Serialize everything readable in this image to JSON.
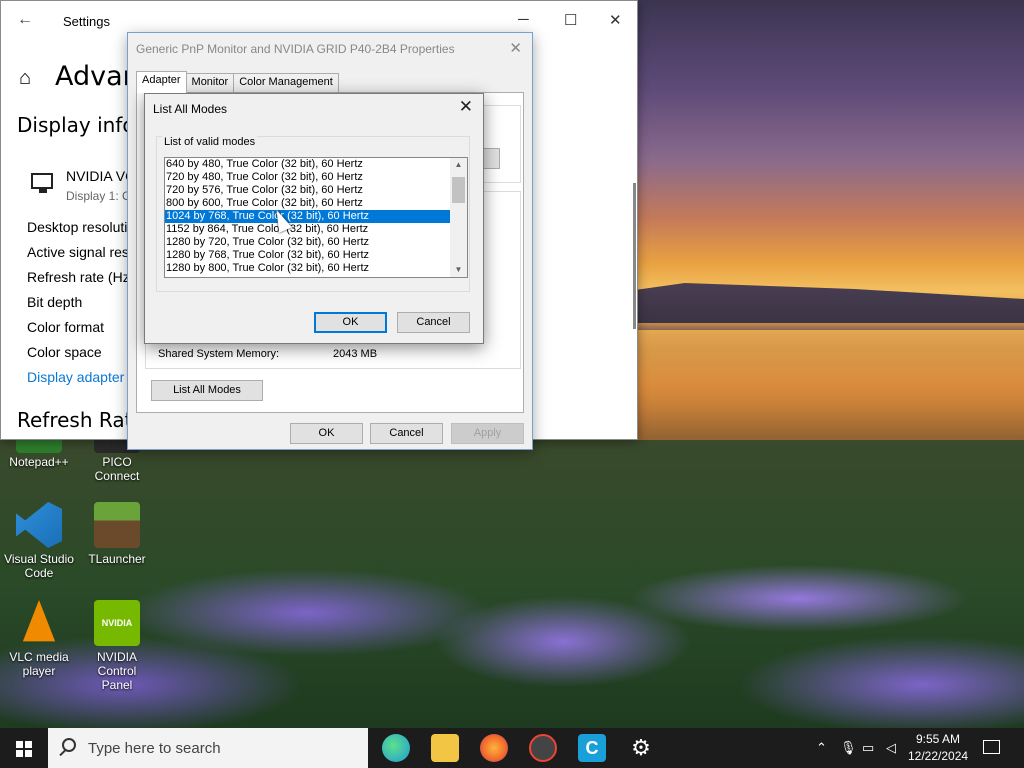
{
  "settings": {
    "back_icon": "←",
    "title": "Settings",
    "page_title": "Advan",
    "section_display_info": "Display infor",
    "gpu_name": "NVIDIA VC",
    "gpu_sub": "Display 1: C",
    "rows": [
      "Desktop resoluti",
      "Active signal res",
      "Refresh rate (Hz)",
      "Bit depth",
      "Color format",
      "Color space",
      "Display adapter"
    ],
    "section_refresh": "Refresh Rate"
  },
  "properties": {
    "title": "Generic PnP Monitor and NVIDIA GRID P40-2B4 Properties",
    "tabs": [
      "Adapter",
      "Monitor",
      "Color Management"
    ],
    "memory_label": "Shared System Memory:",
    "memory_value": "2043 MB",
    "list_all_modes": "List All Modes",
    "ok": "OK",
    "cancel": "Cancel",
    "apply": "Apply"
  },
  "modes_dialog": {
    "title": "List All Modes",
    "group_label": "List of valid modes",
    "modes": [
      "640 by 480, True Color (32 bit), 60 Hertz",
      "720 by 480, True Color (32 bit), 60 Hertz",
      "720 by 576, True Color (32 bit), 60 Hertz",
      "800 by 600, True Color (32 bit), 60 Hertz",
      "1024 by 768, True Color (32 bit), 60 Hertz",
      "1152 by 864, True Color (32 bit), 60 Hertz",
      "1280 by 720, True Color (32 bit), 60 Hertz",
      "1280 by 768, True Color (32 bit), 60 Hertz",
      "1280 by 800, True Color (32 bit), 60 Hertz"
    ],
    "selected_index": 4,
    "ok": "OK",
    "cancel": "Cancel"
  },
  "desktop_icons": [
    {
      "label": "Notepad++",
      "icon": "notepadpp-icon",
      "color": "#2d7d2d"
    },
    {
      "label": "PICO Connect",
      "icon": "pico-connect-icon",
      "color": "#2a2a2a"
    },
    {
      "label": "Visual Studio Code",
      "icon": "vscode-icon",
      "color": "#2f8fd8"
    },
    {
      "label": "TLauncher",
      "icon": "tlauncher-icon",
      "color": "#5c8a2e"
    },
    {
      "label": "VLC media player",
      "icon": "vlc-icon",
      "color": "#f08a00"
    },
    {
      "label": "NVIDIA Control Panel",
      "icon": "nvidia-icon",
      "color": "#76b900"
    }
  ],
  "taskbar": {
    "search_placeholder": "Type here to search",
    "apps": [
      {
        "name": "edge-icon",
        "color": "#1d9ad6"
      },
      {
        "name": "file-explorer-icon",
        "color": "#f2c544"
      },
      {
        "name": "firefox-icon",
        "color": "#f2682a"
      },
      {
        "name": "media-app-icon",
        "color": "#444444"
      },
      {
        "name": "c-app-icon",
        "color": "#1aa0d8"
      },
      {
        "name": "settings-gear-icon",
        "color": "#ffffff"
      }
    ],
    "time": "9:55 AM",
    "date": "12/22/2024"
  }
}
